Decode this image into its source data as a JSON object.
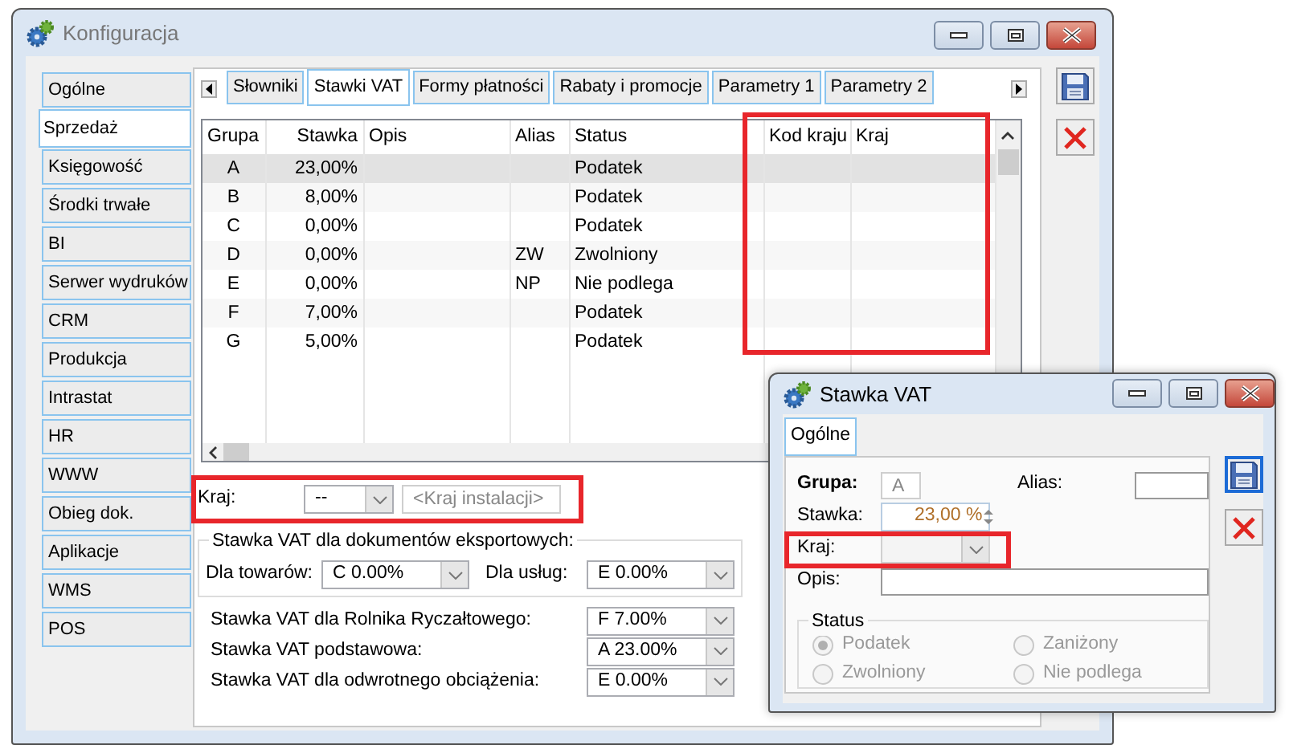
{
  "main_window": {
    "title": "Konfiguracja",
    "sidebar": {
      "items": [
        {
          "label": "Ogólne",
          "selected": false
        },
        {
          "label": "Sprzedaż",
          "selected": true
        },
        {
          "label": "Księgowość",
          "selected": false
        },
        {
          "label": "Środki trwałe",
          "selected": false
        },
        {
          "label": "BI",
          "selected": false
        },
        {
          "label": "Serwer wydruków",
          "selected": false
        },
        {
          "label": "CRM",
          "selected": false
        },
        {
          "label": "Produkcja",
          "selected": false
        },
        {
          "label": "Intrastat",
          "selected": false
        },
        {
          "label": "HR",
          "selected": false
        },
        {
          "label": "WWW",
          "selected": false
        },
        {
          "label": "Obieg dok.",
          "selected": false
        },
        {
          "label": "Aplikacje",
          "selected": false
        },
        {
          "label": "WMS",
          "selected": false
        },
        {
          "label": "POS",
          "selected": false
        }
      ]
    },
    "tabs": [
      {
        "label": "Słowniki",
        "selected": false
      },
      {
        "label": "Stawki VAT",
        "selected": true
      },
      {
        "label": "Formy płatności",
        "selected": false
      },
      {
        "label": "Rabaty i promocje",
        "selected": false
      },
      {
        "label": "Parametry 1",
        "selected": false
      },
      {
        "label": "Parametry 2",
        "selected": false
      }
    ],
    "table": {
      "columns": [
        "Grupa",
        "Stawka",
        "Opis",
        "Alias",
        "Status",
        "Kod kraju",
        "Kraj"
      ],
      "rows": [
        {
          "cells": [
            "A",
            "23,00%",
            "",
            "",
            "Podatek",
            "",
            ""
          ],
          "selected": true
        },
        {
          "cells": [
            "B",
            "8,00%",
            "",
            "",
            "Podatek",
            "",
            ""
          ],
          "selected": false
        },
        {
          "cells": [
            "C",
            "0,00%",
            "",
            "",
            "Podatek",
            "",
            ""
          ],
          "selected": false
        },
        {
          "cells": [
            "D",
            "0,00%",
            "",
            "ZW",
            "Zwolniony",
            "",
            ""
          ],
          "selected": false
        },
        {
          "cells": [
            "E",
            "0,00%",
            "",
            "NP",
            "Nie podlega",
            "",
            ""
          ],
          "selected": false
        },
        {
          "cells": [
            "F",
            "7,00%",
            "",
            "",
            "Podatek",
            "",
            ""
          ],
          "selected": false
        },
        {
          "cells": [
            "G",
            "5,00%",
            "",
            "",
            "Podatek",
            "",
            ""
          ],
          "selected": false
        }
      ]
    },
    "country": {
      "label": "Kraj:",
      "value": "--",
      "placeholder": "<Kraj instalacji>"
    },
    "export_group": {
      "title": "Stawka VAT dla dokumentów eksportowych:",
      "fields": [
        {
          "label": "Dla towarów:",
          "value": "C 0.00%"
        },
        {
          "label": "Dla usług:",
          "value": "E 0.00%"
        }
      ]
    },
    "rate_fields": [
      {
        "label": "Stawka VAT dla Rolnika Ryczałtowego:",
        "value": "F 7.00%"
      },
      {
        "label": "Stawka VAT podstawowa:",
        "value": "A 23.00%"
      },
      {
        "label": "Stawka VAT dla odwrotnego obciążenia:",
        "value": "E 0.00%"
      }
    ]
  },
  "dialog": {
    "title": "Stawka VAT",
    "tabs": [
      {
        "label": "Ogólne",
        "selected": true
      }
    ],
    "group": {
      "label": "Grupa:",
      "value": "A",
      "disabled": true
    },
    "alias": {
      "label": "Alias:"
    },
    "rate": {
      "label": "Stawka:",
      "value": "23,00 %",
      "disabled": true
    },
    "country": {
      "label": "Kraj:",
      "disabled": true
    },
    "description": {
      "label": "Opis:"
    },
    "status": {
      "title": "Status",
      "options": [
        {
          "label": "Podatek",
          "selected": true,
          "disabled": true
        },
        {
          "label": "Zaniżony",
          "selected": false,
          "disabled": true
        },
        {
          "label": "Zwolniony",
          "selected": false,
          "disabled": true
        },
        {
          "label": "Nie podlega",
          "selected": false,
          "disabled": true
        }
      ]
    }
  }
}
